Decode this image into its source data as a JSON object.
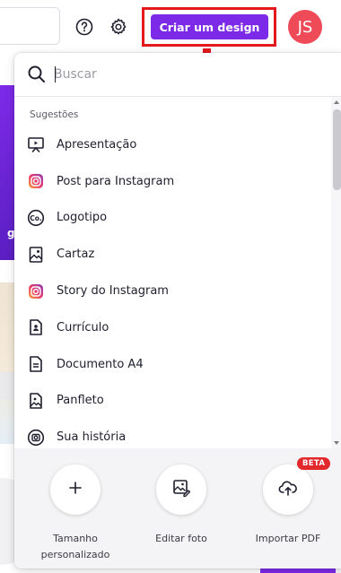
{
  "topbar": {
    "help_icon": "question-circle-icon",
    "settings_icon": "gear-icon",
    "create_button_label": "Criar um design",
    "avatar_initials": "JS",
    "accent_color": "#7d2ae8",
    "avatar_color": "#ef4a58"
  },
  "annotation": {
    "highlight_color": "#e3191c"
  },
  "search": {
    "value": "",
    "placeholder": "Buscar"
  },
  "suggestions": {
    "label": "Sugestões",
    "items": [
      {
        "label": "Apresentação",
        "icon": "presentation-icon"
      },
      {
        "label": "Post para Instagram",
        "icon": "instagram-icon"
      },
      {
        "label": "Logotipo",
        "icon": "logo-icon"
      },
      {
        "label": "Cartaz",
        "icon": "poster-icon"
      },
      {
        "label": "Story do Instagram",
        "icon": "instagram-icon"
      },
      {
        "label": "Currículo",
        "icon": "resume-icon"
      },
      {
        "label": "Documento A4",
        "icon": "document-icon"
      },
      {
        "label": "Panfleto",
        "icon": "flyer-icon"
      },
      {
        "label": "Sua história",
        "icon": "story-icon"
      }
    ]
  },
  "footer": {
    "custom_size_label": "Tamanho personalizado",
    "edit_photo_label": "Editar foto",
    "import_pdf_label": "Importar PDF",
    "beta_badge": "BETA"
  }
}
